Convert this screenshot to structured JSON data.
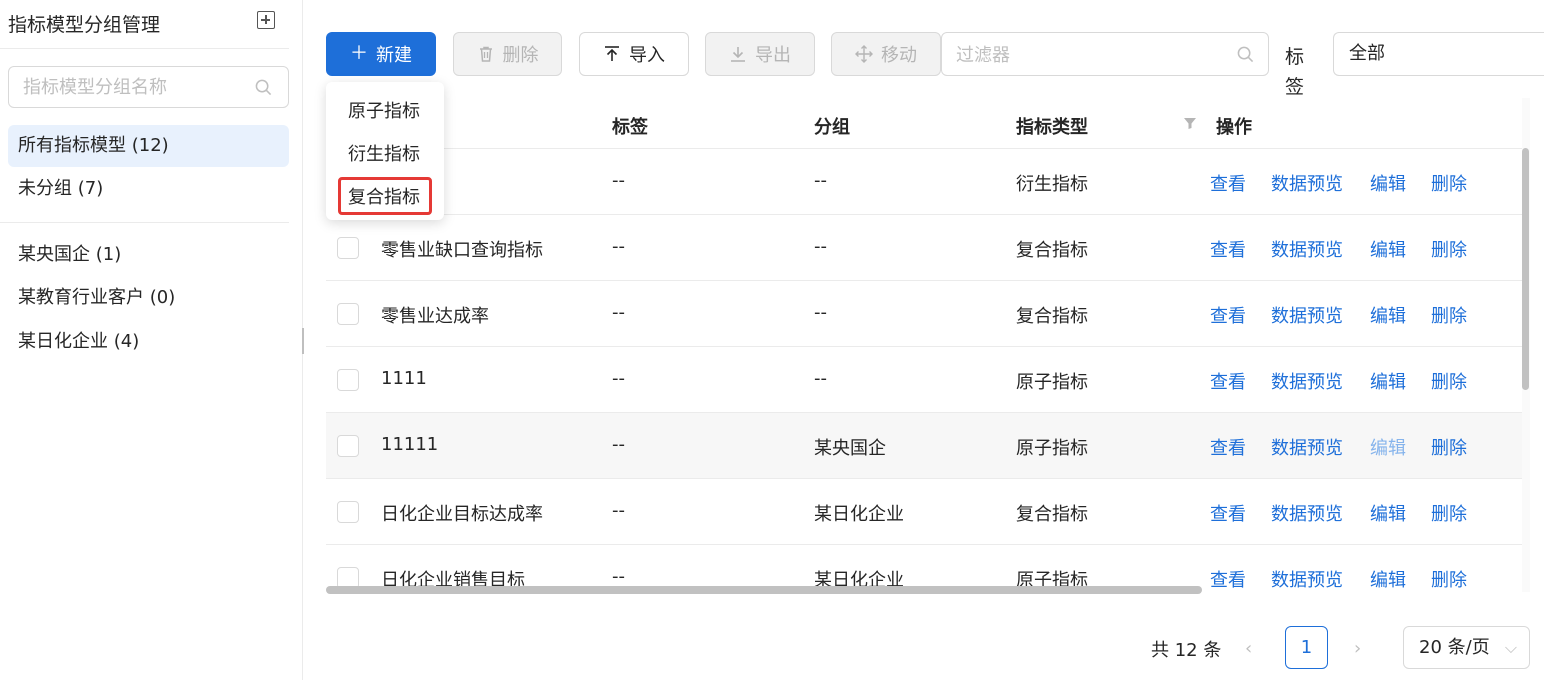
{
  "sidebar": {
    "title": "指标模型分组管理",
    "search_placeholder": "指标模型分组名称",
    "all_label": "所有指标模型 (12)",
    "ungrouped_label": "未分组 (7)",
    "groups": [
      "某央国企 (1)",
      "某教育行业客户 (0)",
      "某日化企业 (4)"
    ]
  },
  "toolbar": {
    "new_label": "新建",
    "delete_label": "删除",
    "import_label": "导入",
    "export_label": "导出",
    "move_label": "移动",
    "filter_placeholder": "过滤器",
    "tag_label": "标签",
    "tag_value": "全部"
  },
  "new_menu": {
    "items": [
      "原子指标",
      "衍生指标",
      "复合指标"
    ],
    "highlighted": "复合指标"
  },
  "table": {
    "headers": {
      "tag": "标签",
      "group": "分组",
      "type": "指标类型",
      "actions": "操作"
    },
    "action_labels": {
      "view": "查看",
      "preview": "数据预览",
      "edit": "编辑",
      "delete": "删除"
    },
    "rows": [
      {
        "name": "",
        "tag": "--",
        "group": "--",
        "type": "衍生指标"
      },
      {
        "name": "零售业缺口查询指标",
        "tag": "--",
        "group": "--",
        "type": "复合指标"
      },
      {
        "name": "零售业达成率",
        "tag": "--",
        "group": "--",
        "type": "复合指标"
      },
      {
        "name": "1111",
        "tag": "--",
        "group": "--",
        "type": "原子指标"
      },
      {
        "name": "11111",
        "tag": "--",
        "group": "某央国企",
        "type": "原子指标"
      },
      {
        "name": "日化企业目标达成率",
        "tag": "--",
        "group": "某日化企业",
        "type": "复合指标"
      },
      {
        "name": "日化企业销售目标",
        "tag": "--",
        "group": "某日化企业",
        "type": "原子指标"
      }
    ]
  },
  "pagination": {
    "total_label": "共 12 条",
    "current_page": "1",
    "page_size": "20 条/页"
  },
  "colors": {
    "primary": "#1e6fd9",
    "highlight_border": "#e53935"
  }
}
